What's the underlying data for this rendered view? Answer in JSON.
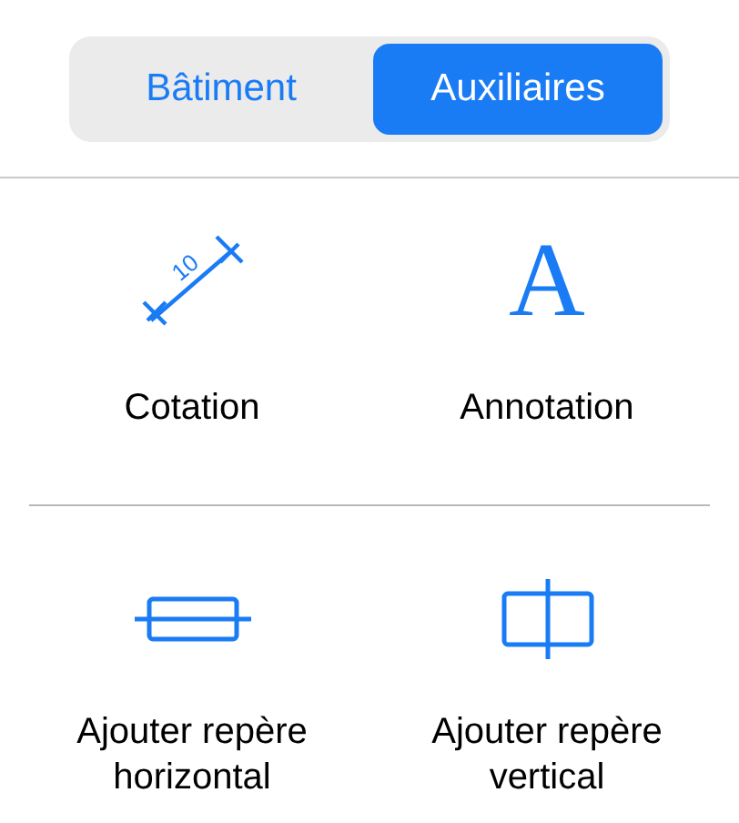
{
  "segments": [
    {
      "label": "Bâtiment",
      "selected": false
    },
    {
      "label": "Auxiliaires",
      "selected": true
    }
  ],
  "sections": [
    {
      "tools": [
        {
          "kind": "dimension",
          "label": "Cotation",
          "icon_text": "10"
        },
        {
          "kind": "annotation",
          "label": "Annotation",
          "icon_text": "A"
        }
      ]
    },
    {
      "tools": [
        {
          "kind": "horizontal-guide",
          "label": "Ajouter repère horizontal"
        },
        {
          "kind": "vertical-guide",
          "label": "Ajouter repère vertical"
        }
      ]
    }
  ]
}
